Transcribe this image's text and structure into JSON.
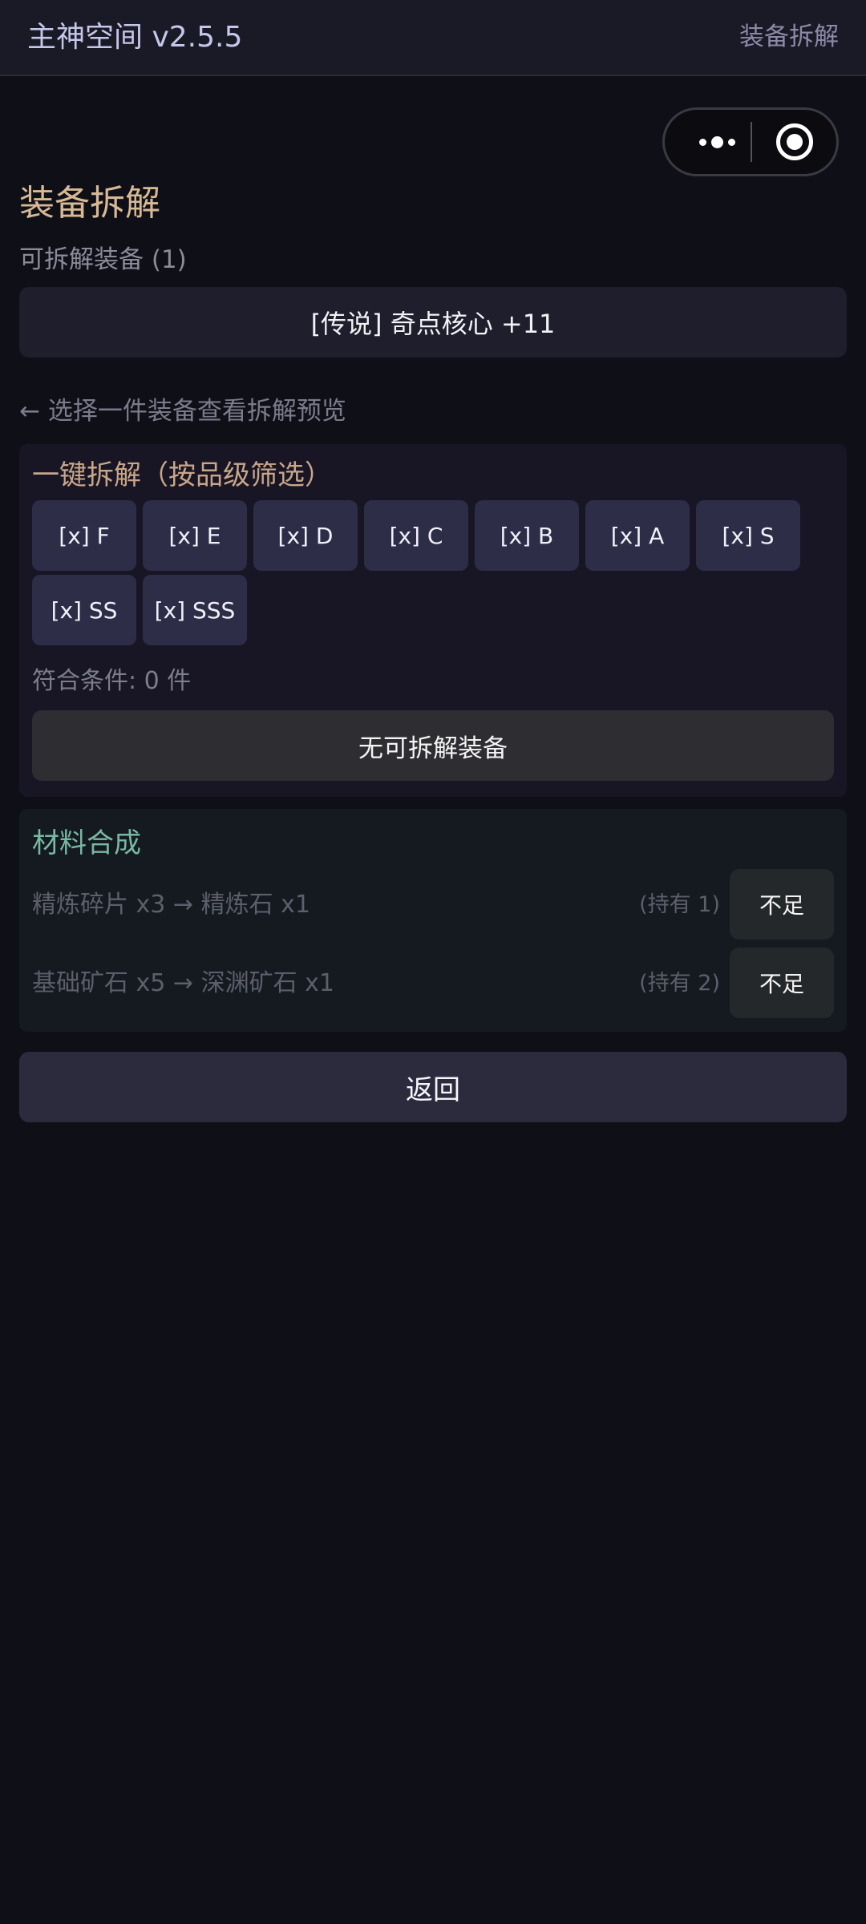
{
  "header": {
    "title": "主神空间 v2.5.5",
    "section": "装备拆解"
  },
  "miniprogram_capsule": {
    "more_icon": "more-dots-icon",
    "close_icon": "target-circle-icon"
  },
  "page": {
    "title": "装备拆解",
    "available_label": "可拆解装备 (1)",
    "equipment": [
      {
        "label": "[传说] 奇点核心 +11"
      }
    ],
    "hint": "← 选择一件装备查看拆解预览"
  },
  "bulk_dismantle": {
    "title": "一键拆解（按品级筛选）",
    "grades": [
      "[x] F",
      "[x] E",
      "[x] D",
      "[x] C",
      "[x] B",
      "[x] A",
      "[x] S",
      "[x] SS",
      "[x] SSS"
    ],
    "match_count": "符合条件: 0 件",
    "action_label": "无可拆解装备"
  },
  "synthesis": {
    "title": "材料合成",
    "recipes": [
      {
        "text": "精炼碎片 x3 → 精炼石 x1",
        "owned": "(持有 1)",
        "button": "不足"
      },
      {
        "text": "基础矿石 x5 → 深渊矿石 x1",
        "owned": "(持有 2)",
        "button": "不足"
      }
    ]
  },
  "back_label": "返回",
  "colors": {
    "background": "#0f0f17",
    "accent_gold": "#d7b995",
    "accent_green": "#78b8a2",
    "grade_button": "#2d2d48"
  }
}
